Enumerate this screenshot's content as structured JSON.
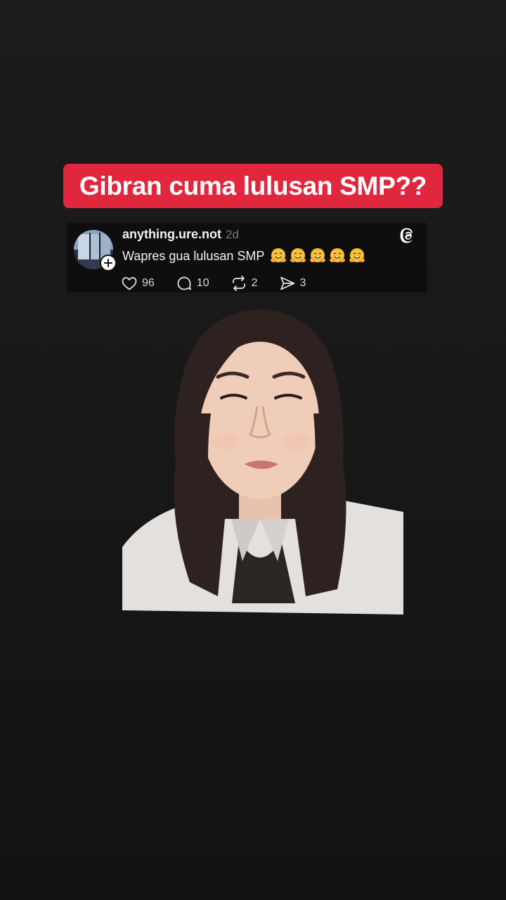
{
  "caption": {
    "text": "Gibran cuma lulusan SMP??",
    "background": "#e0273e"
  },
  "post": {
    "username": "anything.ure.not",
    "time_ago": "2d",
    "text": "Wapres gua lulusan SMP",
    "emojis": [
      "hugging-face-emoji",
      "hugging-face-emoji",
      "hugging-face-emoji",
      "hugging-face-emoji",
      "hugging-face-emoji"
    ],
    "likes": "96",
    "replies": "10",
    "reposts": "2",
    "shares": "3",
    "app_icon": "threads-icon",
    "avatar_icon": "city-window-photo"
  },
  "video": {
    "subject": "person-cutout"
  }
}
